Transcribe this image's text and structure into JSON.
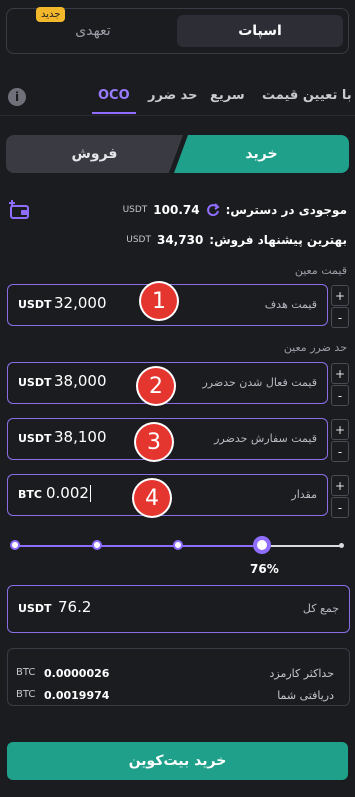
{
  "mode": {
    "spot": "اسپات",
    "margin": "تعهدی",
    "new_badge": "جدید"
  },
  "tabs": [
    "OCO",
    "حد ضرر",
    "سریع",
    "با تعیین قیمت"
  ],
  "sides": {
    "buy": "خرید",
    "sell": "فروش"
  },
  "balance": {
    "label": "موجودی در دسترس:",
    "value": "100.74",
    "unit": "USDT"
  },
  "best_offer": {
    "label": "بهترین پیشنهاد فروش:",
    "value": "34,730",
    "unit": "USDT"
  },
  "sections": {
    "target": "قیمت معین",
    "stop": "حد ضرر معین"
  },
  "fields": {
    "target_price": {
      "unit": "USDT",
      "value": "32,000",
      "label": "قیمت هدف"
    },
    "stop_trigger": {
      "unit": "USDT",
      "value": "38,000",
      "label": "قیمت فعال شدن حدضرر"
    },
    "stop_order": {
      "unit": "USDT",
      "value": "38,100",
      "label": "قیمت سفارش حدضرر"
    },
    "amount": {
      "unit": "BTC",
      "value": "0.002",
      "label": "مقدار"
    }
  },
  "stepper": {
    "plus": "+",
    "minus": "-"
  },
  "callouts": [
    "1",
    "2",
    "3",
    "4"
  ],
  "slider": {
    "percent": 76,
    "label": "76%"
  },
  "total": {
    "unit": "USDT",
    "value": "76.2",
    "label": "جمع کل"
  },
  "fees": {
    "max_fee": {
      "unit": "BTC",
      "value": "0.0000026",
      "label": "حداکثر کارمزد"
    },
    "receive": {
      "unit": "BTC",
      "value": "0.0019974",
      "label": "دریافتی شما"
    }
  },
  "submit_label": "خرید بیت‌کوین",
  "colors": {
    "accent": "#8f6dff",
    "buy": "#1fa08a",
    "callout": "#e5352f"
  }
}
